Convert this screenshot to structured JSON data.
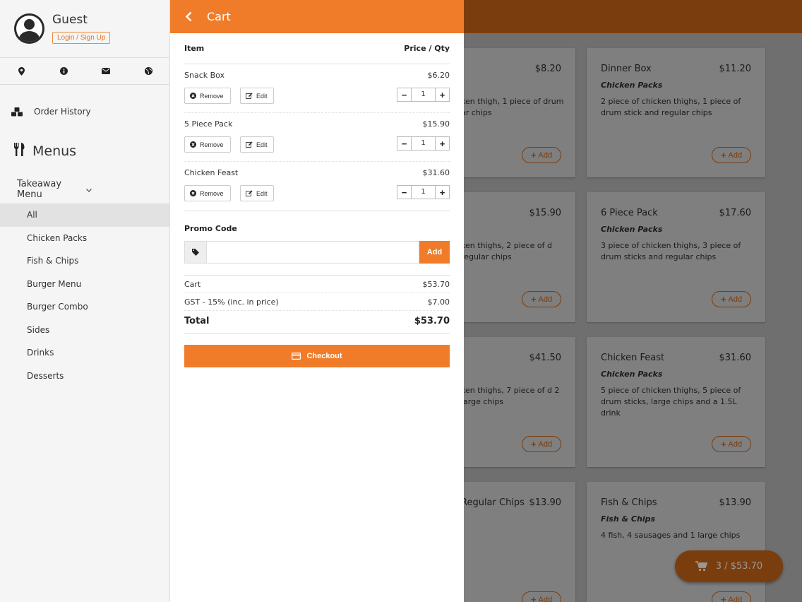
{
  "profile": {
    "name": "Guest",
    "login_label": "Login / Sign Up"
  },
  "sidebar": {
    "icons": [
      "map-marker-icon",
      "info-icon",
      "envelope-icon",
      "globe-icon"
    ],
    "order_history": "Order History",
    "menus_title": "Menus",
    "takeaway_label": "Takeaway Menu",
    "categories": [
      "All",
      "Chicken Packs",
      "Fish & Chips",
      "Burger Menu",
      "Burger Combo",
      "Sides",
      "Drinks",
      "Desserts"
    ],
    "active_category": "All"
  },
  "cart": {
    "title": "Cart",
    "col_item": "Item",
    "col_price_qty": "Price / Qty",
    "items": [
      {
        "name": "Snack Box",
        "price": "$6.20",
        "qty": "1"
      },
      {
        "name": "5 Piece Pack",
        "price": "$15.90",
        "qty": "1"
      },
      {
        "name": "Chicken Feast",
        "price": "$31.60",
        "qty": "1"
      }
    ],
    "remove_label": "Remove",
    "edit_label": "Edit",
    "promo_label": "Promo Code",
    "promo_value": "",
    "promo_add_label": "Add",
    "subtotal_label": "Cart",
    "subtotal_value": "$53.70",
    "gst_label": "GST - 15% (inc. in price)",
    "gst_value": "$7.00",
    "total_label": "Total",
    "total_value": "$53.70",
    "checkout_label": "Checkout"
  },
  "menu_cards": [
    {
      "name": "",
      "price": "$8.20",
      "category": "",
      "desc": "ken thigh, 1 piece of drum ar chips"
    },
    {
      "name": "Dinner Box",
      "price": "$11.20",
      "category": "Chicken Packs",
      "desc": "2 piece of chicken thighs, 1 piece of drum stick and regular chips"
    },
    {
      "name": "",
      "price": "$15.90",
      "category": "",
      "desc": "ken thighs, 2 piece of d regular chips"
    },
    {
      "name": "6 Piece Pack",
      "price": "$17.60",
      "category": "Chicken Packs",
      "desc": "3 piece of chicken thighs, 3 piece of drum sticks and regular chips"
    },
    {
      "name": "",
      "price": "$41.50",
      "category": "",
      "desc": "ken thighs, 7 piece of d 2 large chips"
    },
    {
      "name": "Chicken Feast",
      "price": "$31.60",
      "category": "Chicken Packs",
      "desc": "5 piece of chicken thighs, 5 piece of drum sticks, large chips and a 1.5L drink"
    },
    {
      "name": "Regular Chips",
      "price": "$13.90",
      "category": "",
      "desc": ""
    },
    {
      "name": "Fish & Chips",
      "price": "$13.90",
      "category": "Fish & Chips",
      "desc": "4 fish, 4 sausages and 1 large chips"
    }
  ],
  "card_add_label": "Add",
  "fab_label": "3 / $53.70",
  "colors": {
    "accent": "#f07c2a",
    "dim_accent": "#7a3d0e"
  }
}
